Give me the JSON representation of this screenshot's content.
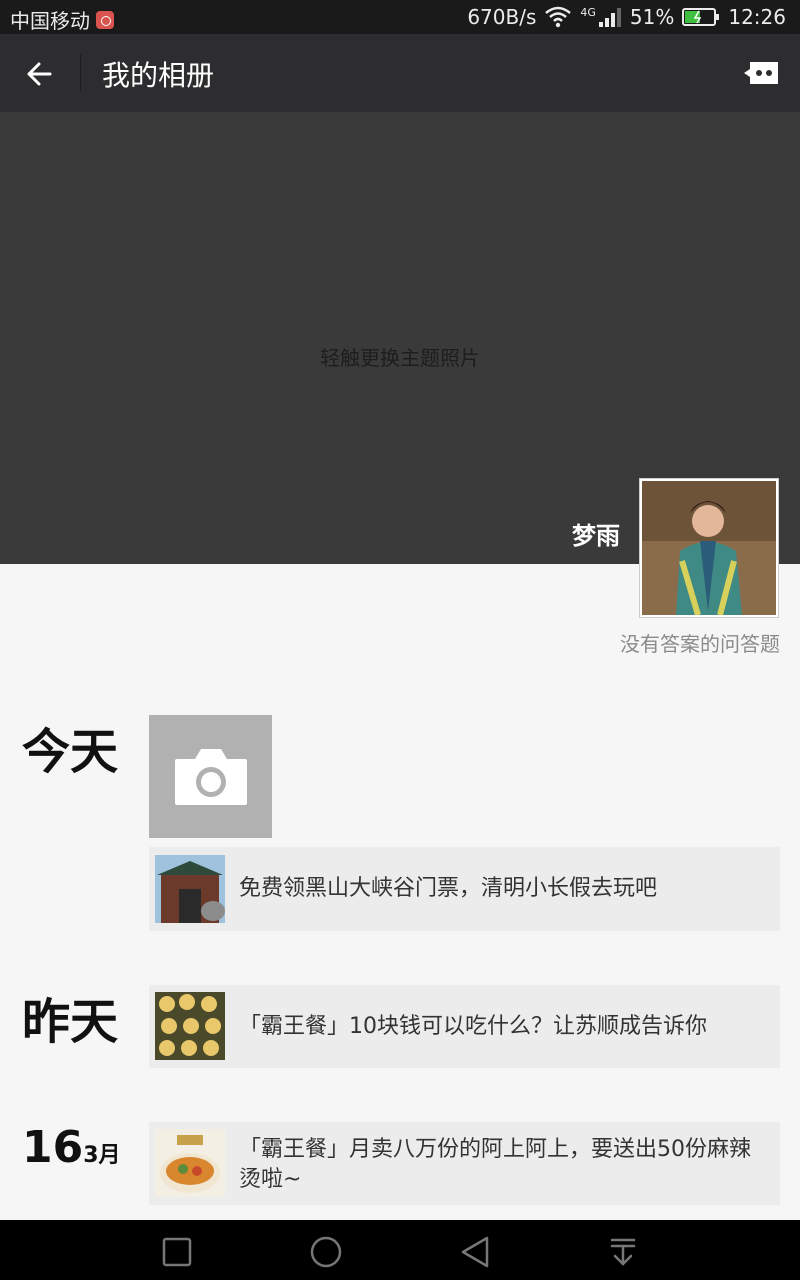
{
  "status_bar": {
    "carrier": "中国移动",
    "speed": "670B/s",
    "network": "4G",
    "battery": "51%",
    "time": "12:26"
  },
  "header": {
    "title": "我的相册"
  },
  "cover": {
    "hint": "轻触更换主题照片"
  },
  "profile": {
    "name": "梦雨",
    "signature": "没有答案的问答题"
  },
  "timeline": [
    {
      "label": "今天",
      "posts": [
        {
          "text": "免费领黑山大峡谷门票，清明小长假去玩吧"
        }
      ]
    },
    {
      "label": "昨天",
      "posts": [
        {
          "text": "「霸王餐」10块钱可以吃什么？让苏顺成告诉你"
        }
      ]
    },
    {
      "day": "16",
      "month": "3月",
      "posts": [
        {
          "text": "「霸王餐」月卖八万份的阿上阿上，要送出50份麻辣烫啦~"
        }
      ]
    }
  ],
  "icons": {
    "back": "arrow-left-icon",
    "more": "more-chat-icon",
    "camera": "camera-icon",
    "nav": [
      "square-icon",
      "circle-icon",
      "triangle-back-icon",
      "download-icon"
    ]
  }
}
